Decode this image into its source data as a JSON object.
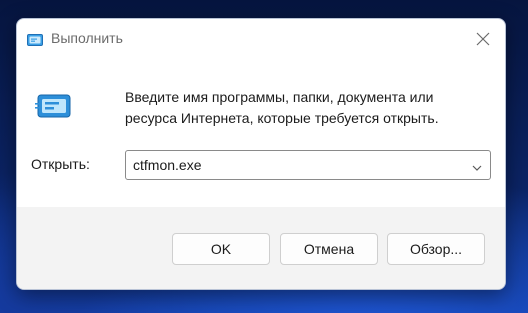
{
  "window": {
    "title": "Выполнить",
    "icon": "run-icon",
    "close_icon": "close-icon"
  },
  "body": {
    "icon": "run-icon",
    "description": "Введите имя программы, папки, документа или ресурса Интернета, которые требуется открыть.",
    "open_label": "Открыть:",
    "open_value": "ctfmon.exe",
    "dropdown_icon": "chevron-down-icon"
  },
  "buttons": {
    "ok": "OK",
    "cancel": "Отмена",
    "browse": "Обзор..."
  },
  "colors": {
    "accent": "#0a6cc4",
    "icon_light": "#9bd3f7",
    "footer": "#f3f3f3"
  }
}
